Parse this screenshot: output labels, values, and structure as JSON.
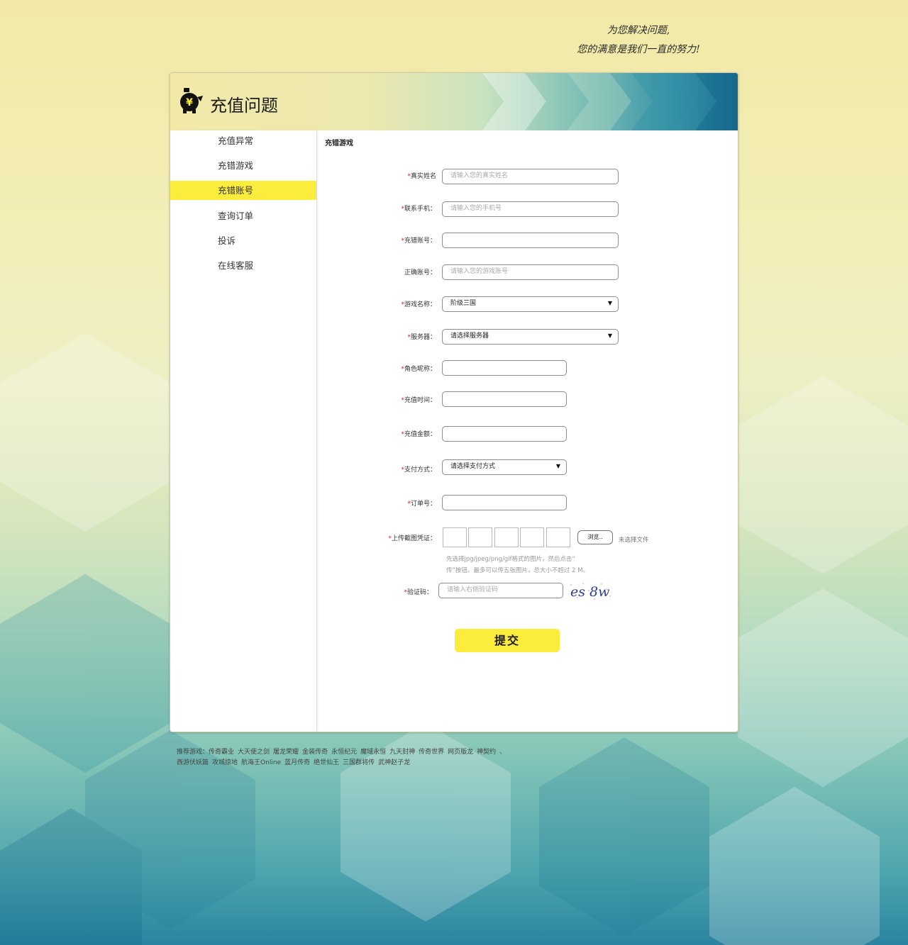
{
  "slogan": {
    "line1": "为您解决问题,",
    "line2": "您的满意是我们一直的努力!"
  },
  "header": {
    "title": "充值问题",
    "icon": "piggy-bank-yuan-icon"
  },
  "sidebar": {
    "items": [
      {
        "label": "充值异常",
        "active": false
      },
      {
        "label": "充错游戏",
        "active": false
      },
      {
        "label": "充错账号",
        "active": true
      },
      {
        "label": "查询订单",
        "active": false
      },
      {
        "label": "投诉",
        "active": false
      },
      {
        "label": "在线客服",
        "active": false
      }
    ]
  },
  "form": {
    "section_title": "充错游戏",
    "real_name": {
      "label": "真实姓名",
      "placeholder": "请输入您的真实姓名",
      "required": true
    },
    "phone": {
      "label": "联系手机：",
      "placeholder": "请输入您的手机号",
      "required": true
    },
    "wrong_account": {
      "label": "充错账号：",
      "placeholder": "",
      "required": true
    },
    "correct_account": {
      "label": "正确账号：",
      "placeholder": "请输入您的游戏账号",
      "required": false
    },
    "game_name": {
      "label": "游戏名称：",
      "value": "阶级三国",
      "required": true
    },
    "server": {
      "label": "服务器：",
      "value": "请选择服务器",
      "required": true
    },
    "role_name": {
      "label": "角色昵称：",
      "required": true
    },
    "recharge_time": {
      "label": "充值时间：",
      "required": true
    },
    "recharge_amount": {
      "label": "充值金额：",
      "required": true
    },
    "payment_method": {
      "label": "支付方式：",
      "value": "请选择支付方式",
      "required": true
    },
    "order_no": {
      "label": "订单号：",
      "required": true
    },
    "upload": {
      "label": "上传截图凭证：",
      "required": true,
      "browse_label": "浏览..",
      "no_file": "未选择文件",
      "hint_line1": "先选择jpg/jpeg/png/gif格式的图片，然后点击“",
      "hint_line2": "传”按钮。最多可以传五张图片，总大小不超过 2 M。"
    },
    "captcha": {
      "label": "验证码：",
      "placeholder": "请输入右侧验证码",
      "required": true,
      "image_text": "es 8w"
    },
    "submit_label": "提交"
  },
  "footer": {
    "prefix": "推荐游戏：",
    "line1": [
      "传奇霸业",
      "大天使之剑",
      "屠龙荣耀",
      "金装传奇",
      "永恒纪元",
      "魔域永恒",
      "九天封神",
      "传奇世界",
      "网页版龙",
      "神契约",
      "、"
    ],
    "line2": [
      "西游伏妖篇",
      "攻城掠地",
      "航海王Online",
      "蓝月传奇",
      "绝世仙王",
      "三国群将传",
      "武神赵子龙"
    ]
  },
  "colors": {
    "accent_yellow": "#fcec3c",
    "required_star": "#e02020"
  }
}
